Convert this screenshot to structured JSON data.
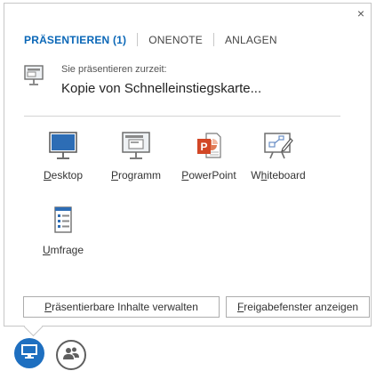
{
  "tabs": [
    {
      "label": "PRÄSENTIEREN (1)",
      "active": true
    },
    {
      "label": "ONENOTE",
      "active": false
    },
    {
      "label": "ANLAGEN",
      "active": false
    }
  ],
  "close_label": "×",
  "current": {
    "subtitle": "Sie präsentieren zurzeit:",
    "title": "Kopie von Schnelleinstiegskarte..."
  },
  "tiles": [
    {
      "label_key": "D",
      "label_rest": "esktop",
      "icon": "desktop-icon"
    },
    {
      "label_key": "P",
      "label_rest": "rogramm",
      "icon": "program-icon"
    },
    {
      "label_key": "P",
      "label_rest": "owerPoint",
      "icon": "powerpoint-icon"
    },
    {
      "label_pre": "W",
      "label_key": "h",
      "label_rest": "iteboard",
      "icon": "whiteboard-icon"
    },
    {
      "label_key": "U",
      "label_rest": "mfrage",
      "icon": "poll-icon"
    }
  ],
  "buttons": {
    "manage": {
      "key": "P",
      "rest": "räsentierbare Inhalte verwalten"
    },
    "share": {
      "key": "F",
      "rest": "reigabefenster anzeigen"
    }
  },
  "colors": {
    "accent": "#0a67b7",
    "present_icon_bg": "#1e6fc0",
    "people_icon_fg": "#5f5f5f",
    "powerpoint_red": "#d24726"
  }
}
